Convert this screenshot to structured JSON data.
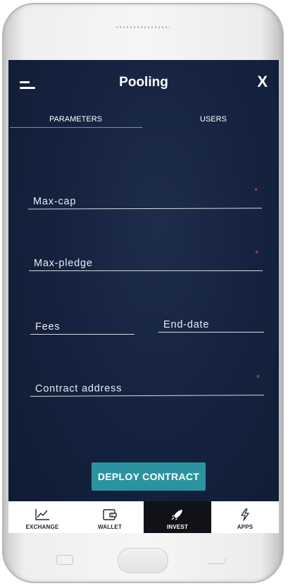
{
  "header": {
    "title": "Pooling",
    "close_label": "X"
  },
  "tabs": [
    {
      "label": "PARAMETERS",
      "active": true
    },
    {
      "label": "USERS",
      "active": false
    }
  ],
  "form": {
    "max_cap": {
      "label": "Max-cap",
      "required_mark": "*"
    },
    "max_pledge": {
      "label": "Max-pledge",
      "required_mark": "*"
    },
    "fees": {
      "label": "Fees"
    },
    "end_date": {
      "label": "End-date"
    },
    "contract_address": {
      "label": "Contract address",
      "required_mark": "*"
    }
  },
  "deploy_button": {
    "label": "DEPLOY CONTRACT"
  },
  "bottom_nav": [
    {
      "label": "EXCHANGE",
      "icon": "chart-line-icon",
      "active": false
    },
    {
      "label": "WALLET",
      "icon": "wallet-icon",
      "active": false
    },
    {
      "label": "INVEST",
      "icon": "rocket-icon",
      "active": true
    },
    {
      "label": "APPS",
      "icon": "lightning-icon",
      "active": false
    }
  ],
  "colors": {
    "background": "#152340",
    "accent": "#2b93a0",
    "required": "#d9534f",
    "tab_underline": "#46a3b8",
    "active_nav": "#111217"
  }
}
